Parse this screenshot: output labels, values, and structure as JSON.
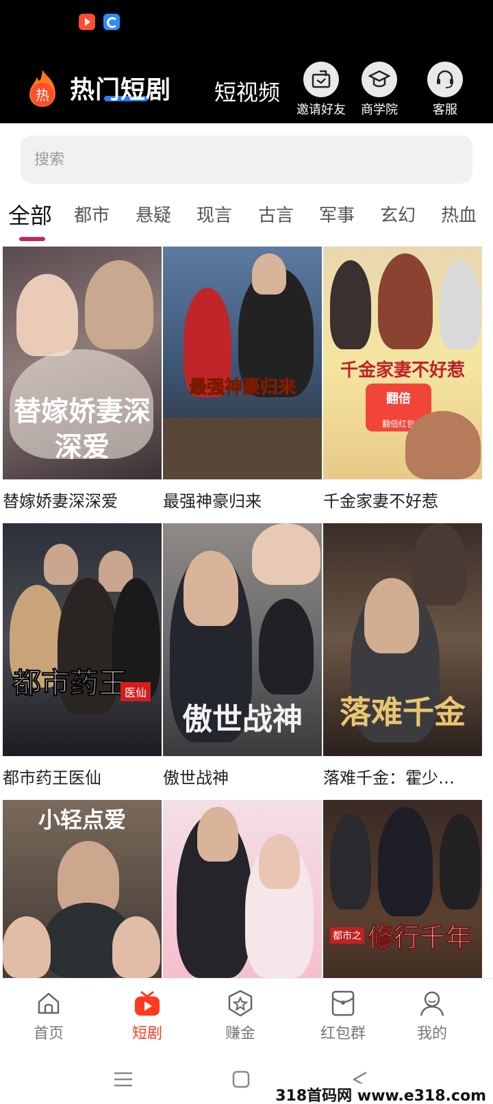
{
  "header": {
    "app_title": "热门短剧",
    "logo_glyph": "热",
    "tab_short_video": "短视频",
    "actions": [
      {
        "label": "邀请好友",
        "icon": "share-icon"
      },
      {
        "label": "商学院",
        "icon": "graduation-cap-icon"
      },
      {
        "label": "客服",
        "icon": "headset-icon"
      }
    ]
  },
  "search": {
    "placeholder": "搜索"
  },
  "categories": [
    "全部",
    "都市",
    "悬疑",
    "现言",
    "古言",
    "军事",
    "玄幻",
    "热血"
  ],
  "active_category": "全部",
  "dramas": [
    {
      "title": "替嫁娇妻深深爱",
      "poster_text": "替嫁娇妻深深爱"
    },
    {
      "title": "最强神豪归来",
      "poster_text": "最强神豪归来"
    },
    {
      "title": "千金家妻不好惹",
      "poster_text": "千金家妻不好惹",
      "badge_top": "翻倍",
      "badge_bottom": "翻倍红包"
    },
    {
      "title": "都市药王医仙",
      "poster_text": "都市药王",
      "poster_tag": "医仙"
    },
    {
      "title": "傲世战神",
      "poster_text": "傲世战神"
    },
    {
      "title": "落难千金：霍少…",
      "poster_text": "落难千金"
    },
    {
      "title": "",
      "poster_text": "小轻点爱"
    },
    {
      "title": "",
      "poster_text": ""
    },
    {
      "title": "",
      "poster_text": "修行千年",
      "poster_tag": "都市之"
    }
  ],
  "tabbar": {
    "items": [
      {
        "label": "首页",
        "icon": "home-icon"
      },
      {
        "label": "短剧",
        "icon": "tv-play-icon"
      },
      {
        "label": "赚金",
        "icon": "star-badge-icon"
      },
      {
        "label": "红包群",
        "icon": "red-envelope-icon"
      },
      {
        "label": "我的",
        "icon": "user-icon"
      }
    ],
    "active": "短剧"
  },
  "watermark": "318首码网 www.e318.com",
  "colors": {
    "accent": "#ff3a1f",
    "category_indicator": "#c8235f",
    "header_bg": "#000000"
  }
}
